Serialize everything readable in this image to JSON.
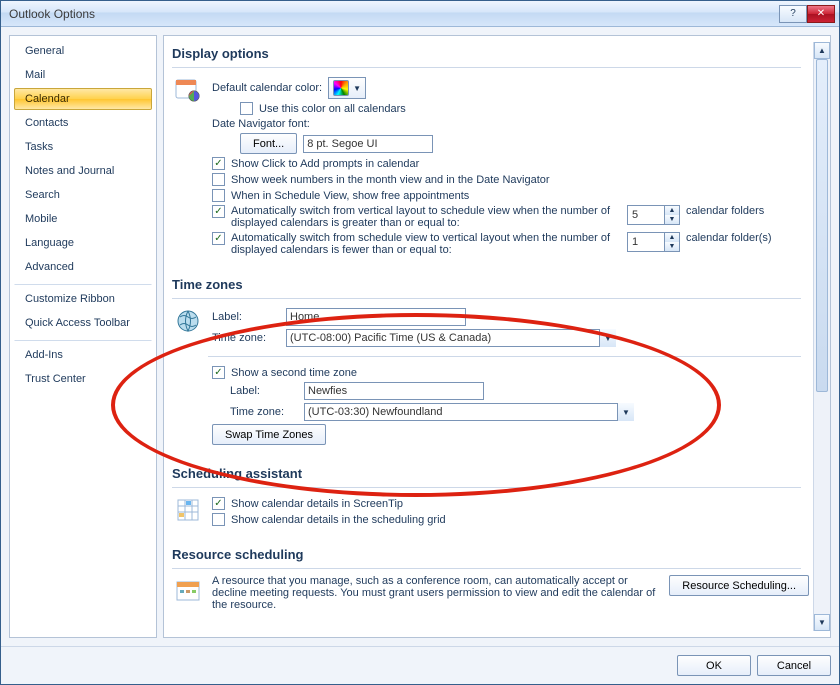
{
  "window": {
    "title": "Outlook Options"
  },
  "sidebar": {
    "items": [
      {
        "label": "General"
      },
      {
        "label": "Mail"
      },
      {
        "label": "Calendar",
        "selected": true
      },
      {
        "label": "Contacts"
      },
      {
        "label": "Tasks"
      },
      {
        "label": "Notes and Journal"
      },
      {
        "label": "Search"
      },
      {
        "label": "Mobile"
      },
      {
        "label": "Language"
      },
      {
        "label": "Advanced"
      },
      {
        "label": "Customize Ribbon",
        "sep": true
      },
      {
        "label": "Quick Access Toolbar"
      },
      {
        "label": "Add-Ins",
        "sep": true
      },
      {
        "label": "Trust Center"
      }
    ]
  },
  "display_options": {
    "header": "Display options",
    "default_color_label": "Default calendar color:",
    "use_color_all": {
      "label": "Use this color on all calendars",
      "checked": false
    },
    "date_nav_font_label": "Date Navigator font:",
    "font_btn": "Font...",
    "font_value": "8 pt. Segoe UI",
    "show_click_to_add": {
      "label": "Show Click to Add prompts in calendar",
      "checked": true
    },
    "show_week_numbers": {
      "label": "Show week numbers in the month view and in the Date Navigator",
      "checked": false
    },
    "schedule_view_free": {
      "label": "When in Schedule View, show free appointments",
      "checked": false
    },
    "auto_switch_to_schedule": {
      "label": "Automatically switch from vertical layout to schedule view when the number of displayed calendars is greater than or equal to:",
      "checked": true,
      "value": "5",
      "suffix": "calendar folders"
    },
    "auto_switch_to_vertical": {
      "label": "Automatically switch from schedule view to vertical layout when the number of displayed calendars is fewer than or equal to:",
      "checked": true,
      "value": "1",
      "suffix": "calendar folder(s)"
    }
  },
  "time_zones": {
    "header": "Time zones",
    "label_label": "Label:",
    "zone_label": "Time zone:",
    "primary": {
      "label_value": "Home",
      "zone_value": "(UTC-08:00) Pacific Time (US & Canada)"
    },
    "show_second": {
      "label": "Show a second time zone",
      "checked": true
    },
    "secondary": {
      "label_value": "Newfies",
      "zone_value": "(UTC-03:30) Newfoundland"
    },
    "swap_btn": "Swap Time Zones"
  },
  "scheduling_assistant": {
    "header": "Scheduling assistant",
    "show_screentip": {
      "label": "Show calendar details in ScreenTip",
      "checked": true
    },
    "show_grid": {
      "label": "Show calendar details in the scheduling grid",
      "checked": false
    }
  },
  "resource_scheduling": {
    "header": "Resource scheduling",
    "text": "A resource that you manage, such as a conference room, can automatically accept or decline meeting requests. You must grant users permission to view and edit the calendar of the resource.",
    "button": "Resource Scheduling..."
  },
  "footer": {
    "ok": "OK",
    "cancel": "Cancel"
  }
}
